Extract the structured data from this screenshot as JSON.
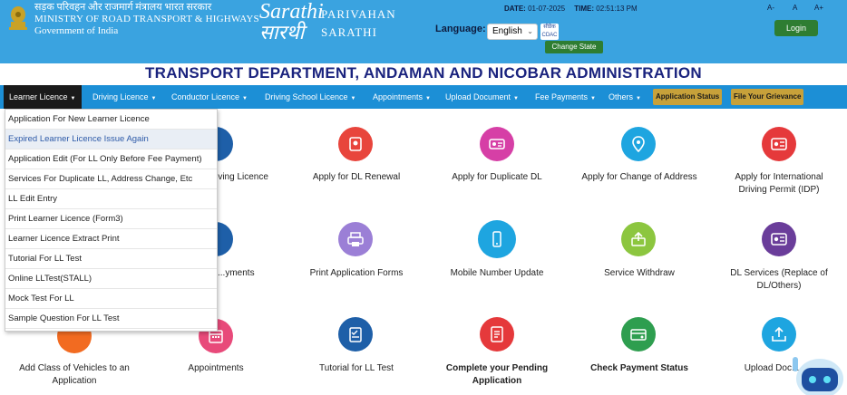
{
  "header": {
    "ministry_hindi": "सड़क परिवहन और राजमार्ग मंत्रालय भारत सरकार",
    "ministry_name": "MINISTRY OF ROAD TRANSPORT & HIGHWAYS",
    "government": "Government of India",
    "logo_top": "Sarathi",
    "logo_bottom": "सारथी",
    "brand_line1": "PARIVAHAN",
    "brand_line2": "SARATHI",
    "date_label": "DATE:",
    "date_value": "01-07-2025",
    "time_label": "TIME:",
    "time_value": "02:51:13 PM",
    "font_small": "A-",
    "font_normal": "A",
    "font_large": "A+",
    "login_label": "Login",
    "language_label": "Language:",
    "language_value": "English",
    "cdac_label": "सीडैक CDAC",
    "change_state_label": "Change State"
  },
  "title": "TRANSPORT DEPARTMENT, ANDAMAN AND NICOBAR ADMINISTRATION",
  "nav": {
    "items": [
      {
        "label": "Learner Licence"
      },
      {
        "label": "Driving Licence"
      },
      {
        "label": "Conductor Licence"
      },
      {
        "label": "Driving School Licence"
      },
      {
        "label": "Appointments"
      },
      {
        "label": "Upload Document"
      },
      {
        "label": "Fee Payments"
      },
      {
        "label": "Others"
      }
    ],
    "application_status": "Application Status",
    "grievance": "File Your Grievance"
  },
  "dropdown": {
    "items": [
      "Application For New Learner Licence",
      "Expired Learner Licence Issue Again",
      "Application Edit (For LL Only Before Fee Payment)",
      "Services For Duplicate LL, Address Change, Etc",
      "LL Edit Entry",
      "Print Learner Licence (Form3)",
      "Learner Licence Extract Print",
      "Tutorial For LL Test",
      "Online LLTest(STALL)",
      "Mock Test For LL",
      "Sample Question For LL Test"
    ],
    "highlighted_index": 1
  },
  "services": {
    "row1": [
      {
        "label": "...ving Licence",
        "color": "#1e5fa8"
      },
      {
        "label": "Apply for DL Renewal",
        "color": "#e8453c"
      },
      {
        "label": "Apply for Duplicate DL",
        "color": "#d63fa6"
      },
      {
        "label": "Apply for Change of Address",
        "color": "#1ea5e0"
      },
      {
        "label": "Apply for International Driving Permit (IDP)",
        "color": "#e5393b"
      }
    ],
    "row2": [
      {
        "label": "...yments",
        "color": "#1e5fa8"
      },
      {
        "label": "Print Application Forms",
        "color": "#9b7fd6"
      },
      {
        "label": "Mobile Number Update",
        "color": "#1ea5e0"
      },
      {
        "label": "Service Withdraw",
        "color": "#8cc63f"
      },
      {
        "label": "DL Services (Replace of DL/Others)",
        "color": "#6a3d9a"
      }
    ],
    "row3": [
      {
        "label": "Add Class of Vehicles to an Application",
        "color": "#f26b21"
      },
      {
        "label": "Appointments",
        "color": "#e84a7a"
      },
      {
        "label": "Tutorial for LL Test",
        "color": "#1e5fa8"
      },
      {
        "label": "Complete your Pending Application",
        "color": "#e5393b"
      },
      {
        "label": "Check Payment Status",
        "color": "#2e9e4f"
      },
      {
        "label": "Upload Doc...",
        "color": "#1ea5e0"
      }
    ]
  }
}
